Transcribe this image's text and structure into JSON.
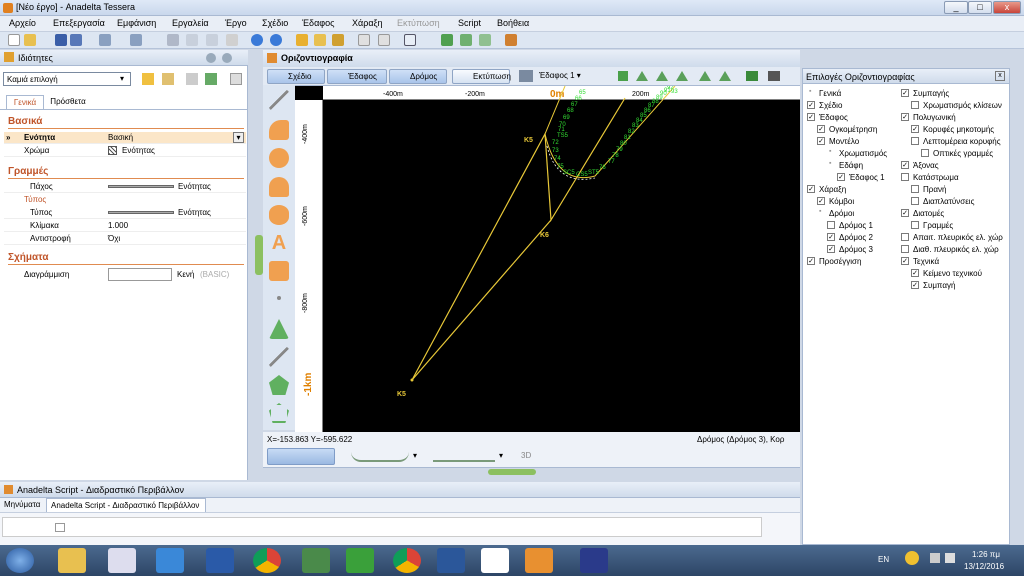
{
  "window": {
    "title": "[Νέο έργο] - Anadelta Tessera",
    "min": "_",
    "max": "□",
    "close": "x"
  },
  "menu": [
    "Αρχείο",
    "Επεξεργασία",
    "Εμφάνιση",
    "Εργαλεία",
    "Έργο",
    "Σχέδιο",
    "Έδαφος",
    "Χάραξη",
    "Εκτύπωση",
    "Script",
    "Βοήθεια"
  ],
  "properties": {
    "header": "Ιδιότητες",
    "selection": "Καμιά επιλογή",
    "tabs": [
      "Γενικά",
      "Πρόσθετα"
    ],
    "basic_section": "Βασικά",
    "unit_label": "Ενότητα",
    "unit_value": "Βασική",
    "color_label": "Χρώμα",
    "color_value": "Ενότητας",
    "lines_section": "Γραμμές",
    "thickness_label": "Πάχος",
    "thickness_value": "Ενότητας",
    "type_group": "Τύπος",
    "type_label": "Τύπος",
    "type_value": "Ενότητας",
    "scale_label": "Κλίμακα",
    "scale_value": "1.000",
    "reverse_label": "Αντιστροφή",
    "reverse_value": "Όχι",
    "shapes_section": "Σχήματα",
    "hatch_label": "Διαγράμμιση",
    "hatch_value": "Κενή",
    "hatch_note": "(BASIC)"
  },
  "document": {
    "tab": "Οριζοντιογραφία"
  },
  "view_tabs": [
    "Σχέδιο",
    "Έδαφος",
    "Δρόμος",
    "Εκτύπωση"
  ],
  "ground_select": "Έδαφος 1",
  "canvas": {
    "top_ticks": [
      "-400m",
      "-200m",
      "0m",
      "200m"
    ],
    "left_ticks": [
      "-400m",
      "-600m",
      "-800m",
      "-1km"
    ],
    "labels": [
      "K5",
      "K6",
      "K5"
    ],
    "station_labels": [
      "65",
      "66",
      "67",
      "68",
      "69",
      "70",
      "71",
      "TS5",
      "72",
      "73",
      "74",
      "75",
      "SC5",
      "CS5",
      "ST5",
      "76",
      "77",
      "78",
      "79",
      "80",
      "81",
      "82",
      "83",
      "84",
      "85",
      "86",
      "87",
      "88",
      "89",
      "90",
      "91",
      "92",
      "93"
    ]
  },
  "status": {
    "coords": "X=-153.863  Y=-595.622",
    "road": "Δρόμος (Δρόμος 3), Κορ"
  },
  "bottom_tb": {
    "view3d": "3D"
  },
  "options": {
    "header": "Επιλογές Οριζοντιογραφίας",
    "left": [
      {
        "label": "Γενικά",
        "check": null,
        "indent": 0
      },
      {
        "label": "Σχέδιο",
        "check": true,
        "indent": 0
      },
      {
        "label": "Έδαφος",
        "check": true,
        "indent": 0
      },
      {
        "label": "Ογκομέτρηση",
        "check": true,
        "indent": 1
      },
      {
        "label": "Μοντέλο",
        "check": true,
        "indent": 1
      },
      {
        "label": "Χρωματισμός",
        "check": null,
        "indent": 2
      },
      {
        "label": "Εδάφη",
        "check": null,
        "indent": 2
      },
      {
        "label": "Έδαφος 1",
        "check": true,
        "indent": 3
      },
      {
        "label": "Χάραξη",
        "check": true,
        "indent": 0
      },
      {
        "label": "Κόμβοι",
        "check": true,
        "indent": 1
      },
      {
        "label": "Δρόμοι",
        "check": null,
        "indent": 1
      },
      {
        "label": "Δρόμος 1",
        "check": false,
        "indent": 2
      },
      {
        "label": "Δρόμος 2",
        "check": true,
        "indent": 2
      },
      {
        "label": "Δρόμος 3",
        "check": true,
        "indent": 2
      },
      {
        "label": "Προσέγγιση",
        "check": true,
        "indent": 0
      }
    ],
    "right": [
      {
        "label": "Συμπαγής",
        "check": true,
        "indent": 0
      },
      {
        "label": "Χρωματισμός κλίσεων",
        "check": false,
        "indent": 1
      },
      {
        "label": "Πολυγωνική",
        "check": true,
        "indent": 0
      },
      {
        "label": "Κορυφές μηκοτομής",
        "check": true,
        "indent": 1
      },
      {
        "label": "Λεπτομέρεια κορυφής",
        "check": false,
        "indent": 1
      },
      {
        "label": "Οπτικές γραμμές",
        "check": false,
        "indent": 2
      },
      {
        "label": "Άξονας",
        "check": true,
        "indent": 0
      },
      {
        "label": "Κατάστρωμα",
        "check": false,
        "indent": 0
      },
      {
        "label": "Πρανή",
        "check": false,
        "indent": 1
      },
      {
        "label": "Διαπλατύνσεις",
        "check": false,
        "indent": 1
      },
      {
        "label": "Διατομές",
        "check": true,
        "indent": 0
      },
      {
        "label": "Γραμμές",
        "check": false,
        "indent": 1
      },
      {
        "label": "Απαιτ. πλευρικός ελ. χώρ",
        "check": false,
        "indent": 0
      },
      {
        "label": "Διαθ. πλευρικός ελ. χώρ",
        "check": false,
        "indent": 0
      },
      {
        "label": "Τεχνικά",
        "check": true,
        "indent": 0
      },
      {
        "label": "Κείμενο τεχνικού",
        "check": true,
        "indent": 1
      },
      {
        "label": "Συμπαγή",
        "check": true,
        "indent": 1
      }
    ]
  },
  "script": {
    "header": "Anadelta Script - Διαδραστικό Περιβάλλον",
    "tabs": [
      "Μηνύματα",
      "Anadelta Script - Διαδραστικό Περιβάλλον"
    ]
  },
  "taskbar": {
    "lang": "EN",
    "time": "1:26 πμ",
    "date": "13/12/2016"
  },
  "colors": {
    "accent": "#f0a000",
    "canvas": "#000000",
    "road": "#e8c838",
    "stations": "#33dd33"
  }
}
